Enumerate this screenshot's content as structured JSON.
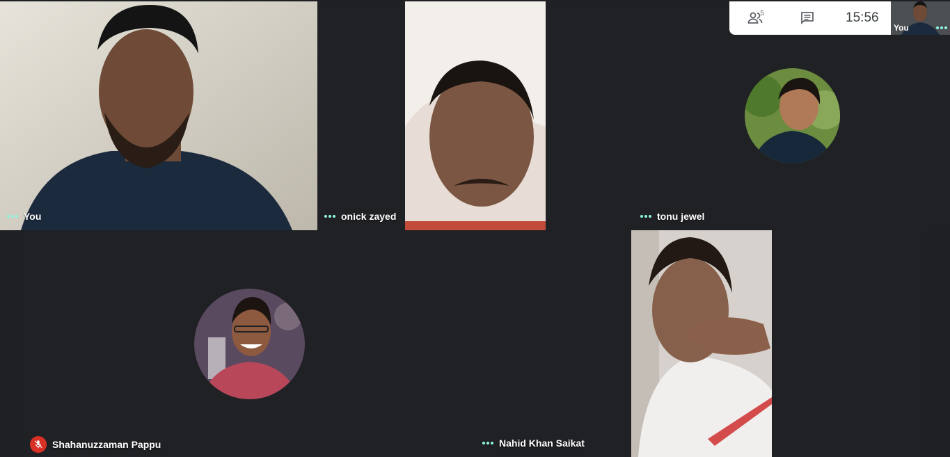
{
  "toolbar": {
    "participants_icon": "people-icon",
    "participants_count": "5",
    "chat_icon": "chat-icon",
    "time": "15:56"
  },
  "self_view": {
    "label": "You"
  },
  "participants": [
    {
      "name": "You",
      "status": "speaking-dots"
    },
    {
      "name": "onick zayed",
      "status": "speaking-dots"
    },
    {
      "name": "tonu jewel",
      "status": "speaking-dots"
    },
    {
      "name": "Shahanuzzaman Pappu",
      "status": "muted",
      "icon": "mic-off-icon"
    },
    {
      "name": "Nahid Khan Saikat",
      "status": "speaking-dots"
    }
  ],
  "colors": {
    "tile_bg": "#202124",
    "mute_red": "#d93025",
    "dot_teal": "#8ef5e0"
  }
}
